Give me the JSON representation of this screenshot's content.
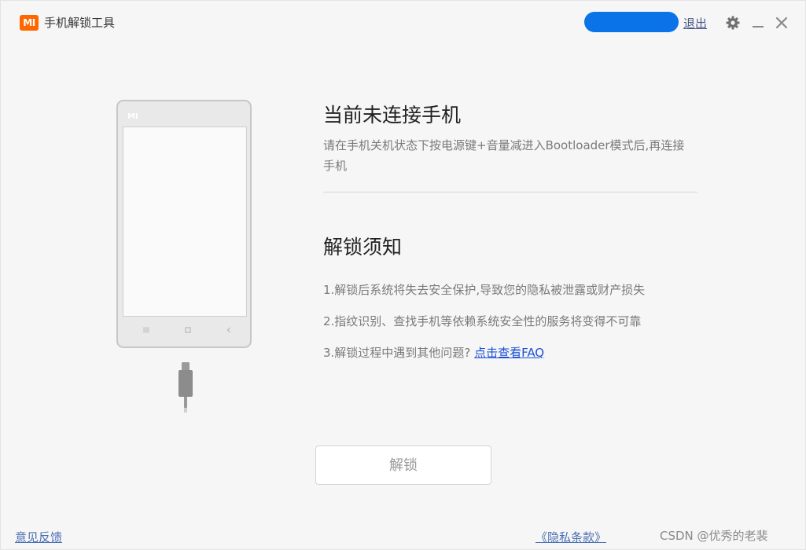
{
  "window": {
    "logo_text": "MI",
    "title": "手机解锁工具",
    "logout_label": "退出",
    "icons": [
      "gear-icon",
      "minimize-icon",
      "close-icon"
    ],
    "accent_color": "#ff6700"
  },
  "phone": {
    "brand": "MI",
    "nav_icons": [
      "menu-icon",
      "home-icon",
      "back-icon"
    ]
  },
  "connection": {
    "title": "当前未连接手机",
    "description": "请在手机关机状态下按电源键+音量减进入Bootloader模式后,再连接手机"
  },
  "notice": {
    "title": "解锁须知",
    "item1": "1.解锁后系统将失去安全保护,导致您的隐私被泄露或财产损失",
    "item2": "2.指纹识别、查找手机等依赖系统安全性的服务将变得不可靠",
    "item3_prefix": "3.解锁过程中遇到其他问题?",
    "item3_link": "点击查看FAQ"
  },
  "unlock_button": {
    "label": "解锁"
  },
  "footer": {
    "feedback": "意见反馈",
    "privacy": "《隐私条款》",
    "watermark": "CSDN @优秀的老裴"
  }
}
